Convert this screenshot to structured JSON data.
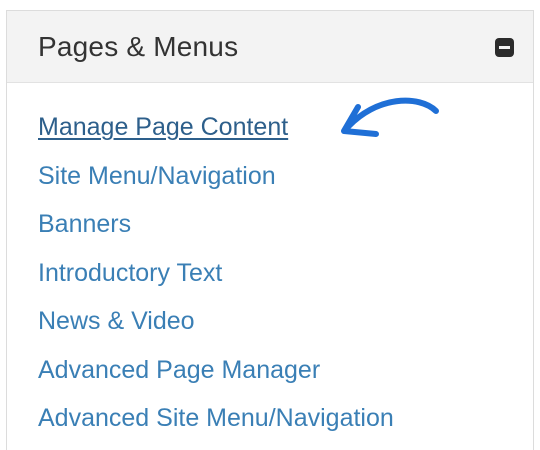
{
  "panel": {
    "title": "Pages & Menus",
    "collapse_icon": "minus-square-icon"
  },
  "links": [
    {
      "label": "Manage Page Content",
      "active": true
    },
    {
      "label": "Site Menu/Navigation",
      "active": false
    },
    {
      "label": "Banners",
      "active": false
    },
    {
      "label": "Introductory Text",
      "active": false
    },
    {
      "label": "News & Video",
      "active": false
    },
    {
      "label": "Advanced Page Manager",
      "active": false
    },
    {
      "label": "Advanced Site Menu/Navigation",
      "active": false
    }
  ],
  "annotation": {
    "icon": "curved-arrow-icon",
    "color": "#1f6fd6"
  },
  "colors": {
    "link": "#3a7fb5",
    "link_active": "#2d5f8b",
    "header_bg": "#f3f3f3",
    "title": "#333333"
  }
}
